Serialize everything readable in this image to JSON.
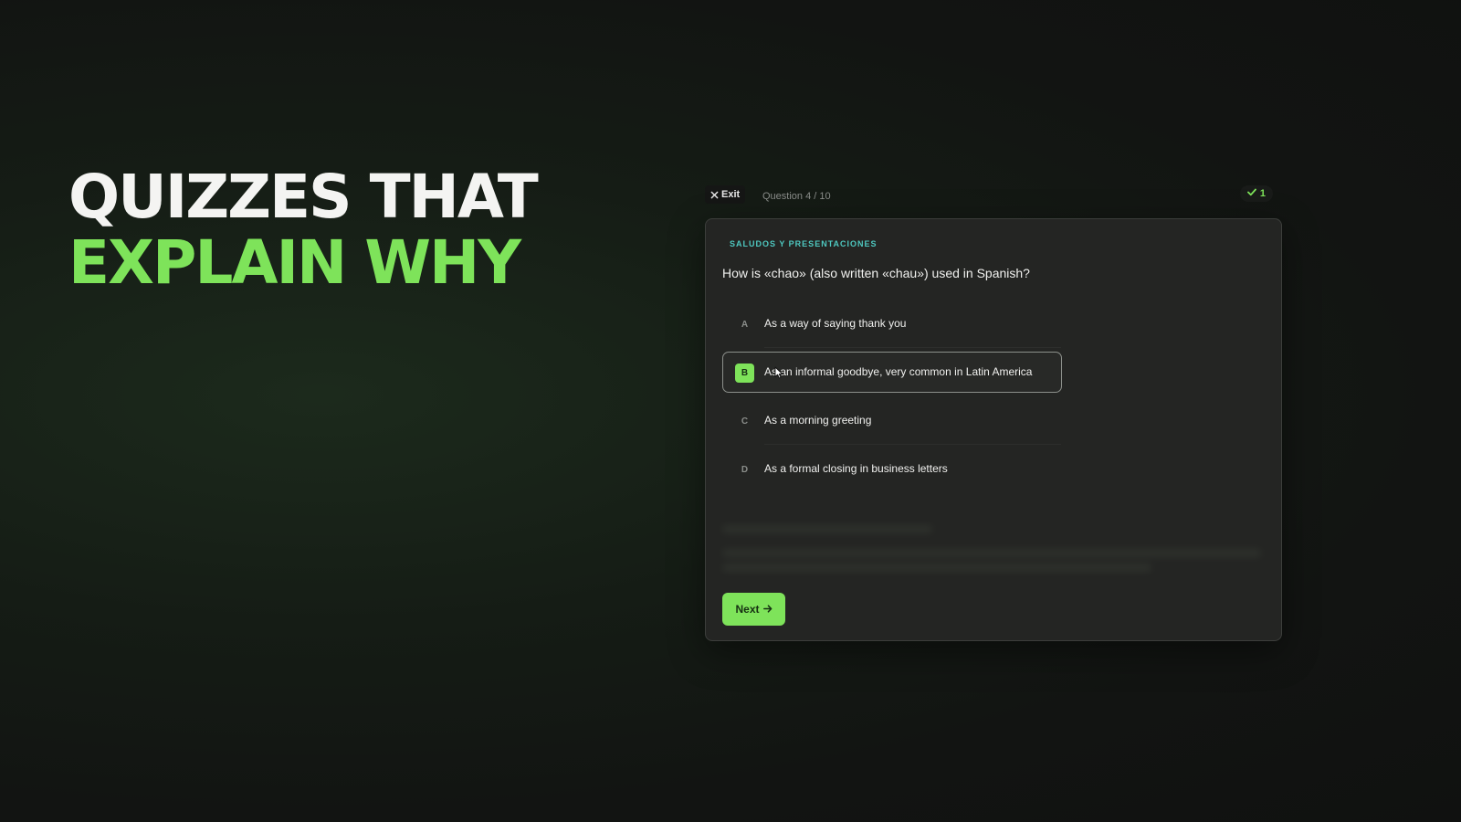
{
  "hero": {
    "line1": "QUIZZES THAT",
    "line2": "EXPLAIN WHY"
  },
  "quiz": {
    "exit_label": "Exit",
    "counter": "Question 4 / 10",
    "score": "1",
    "category": "SALUDOS Y PRESENTACIONES",
    "question": "How is «chao» (also written «chau») used in Spanish?",
    "options": [
      {
        "letter": "A",
        "text": "As a way of saying thank you",
        "selected": false
      },
      {
        "letter": "B",
        "text": "As an informal goodbye, very common in Latin America",
        "selected": true
      },
      {
        "letter": "C",
        "text": "As a morning greeting",
        "selected": false
      },
      {
        "letter": "D",
        "text": "As a formal closing in business letters",
        "selected": false
      }
    ],
    "next_label": "Next"
  },
  "icons": {
    "exit": "close-icon",
    "score": "check-icon",
    "next": "arrow-right-icon",
    "cursor": "mouse-pointer-icon"
  },
  "colors": {
    "accent": "#7ee35a",
    "category": "#4ec8c0",
    "card": "#242523",
    "background": "#121412"
  }
}
